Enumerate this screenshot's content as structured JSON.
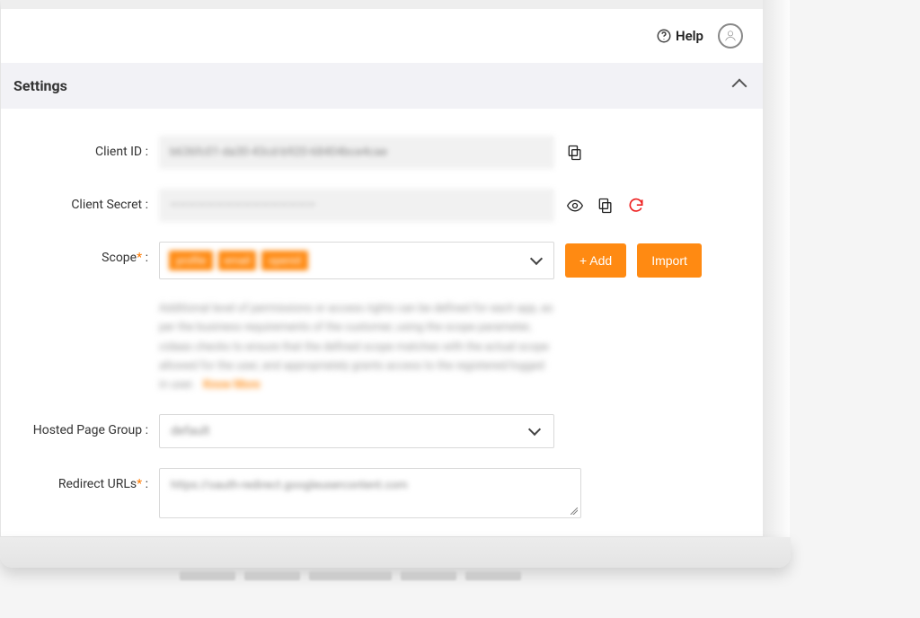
{
  "topbar": {
    "help_label": "Help"
  },
  "panel": {
    "title": "Settings"
  },
  "fields": {
    "client_id": {
      "label": "Client ID :",
      "value": "b636fc01-da30-43cd-b920-68404bce4cae"
    },
    "client_secret": {
      "label": "Client Secret :",
      "value": "————————————————"
    },
    "scope": {
      "label": "Scope",
      "suffix": " :",
      "tags": [
        "profile",
        "email",
        "openid"
      ],
      "add_label": "+ Add",
      "import_label": "Import",
      "help": "Additional level of permissions or access rights can be defined for each app, as per the business requirements of the customer, using the scope parameter, cidaas checks to ensure that the defined scope matches with the actual scope allowed for the user, and appropriately grants access to the registered/logged in user.",
      "help_more": "Know More"
    },
    "hosted_page_group": {
      "label": "Hosted Page Group :",
      "value": "default"
    },
    "redirect_urls": {
      "label": "Redirect URLs",
      "suffix": " :",
      "value": "https://oauth-redirect.googleusercontent.com"
    }
  }
}
